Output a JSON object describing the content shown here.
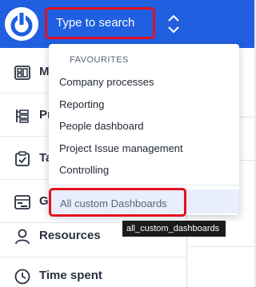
{
  "search": {
    "placeholder": "Type to search"
  },
  "dropdown": {
    "heading": "FAVOURITES",
    "items": [
      "Company processes",
      "Reporting",
      "People dashboard",
      "Project Issue management",
      "Controlling"
    ],
    "all_label": "All custom Dashboards"
  },
  "tooltip": {
    "text": "all_custom_dashboards"
  },
  "sidebar": {
    "items": [
      {
        "label": "M",
        "icon": "dashboard-icon"
      },
      {
        "label": "Pr",
        "icon": "projects-icon"
      },
      {
        "label": "Ta",
        "icon": "tasks-icon"
      },
      {
        "label": "G",
        "icon": "gantt-icon"
      },
      {
        "label": "Resources",
        "icon": "resources-icon"
      },
      {
        "label": "Time spent",
        "icon": "clock-icon"
      }
    ]
  },
  "colors": {
    "brand_blue": "#1f5fe0",
    "highlight_red": "#e5101f"
  }
}
